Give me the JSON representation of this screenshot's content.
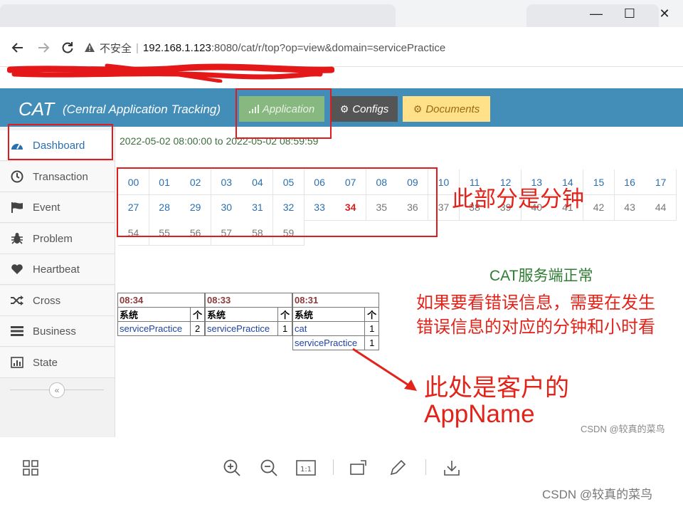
{
  "browser": {
    "insecure_label": "不安全",
    "url_host": "192.168.1.123",
    "url_rest": ":8080/cat/r/top?op=view&domain=servicePractice",
    "window_minimize": "—",
    "window_maximize": "☐",
    "window_close": "✕"
  },
  "header": {
    "brand": "CAT",
    "brand_sub": "(Central Application Tracking)",
    "application_label": "Application",
    "configs_label": "Configs",
    "documents_label": "Documents"
  },
  "sidebar": {
    "items": [
      {
        "label": "Dashboard",
        "icon": "dashboard-icon"
      },
      {
        "label": "Transaction",
        "icon": "clock-icon"
      },
      {
        "label": "Event",
        "icon": "flag-icon"
      },
      {
        "label": "Problem",
        "icon": "bug-icon"
      },
      {
        "label": "Heartbeat",
        "icon": "heart-icon"
      },
      {
        "label": "Cross",
        "icon": "shuffle-icon"
      },
      {
        "label": "Business",
        "icon": "list-icon"
      },
      {
        "label": "State",
        "icon": "bar-chart-icon"
      }
    ],
    "collapse_symbol": "«"
  },
  "content": {
    "date_range": "2022-05-02 08:00:00 to 2022-05-02 08:59:59",
    "minutes_row1": [
      "00",
      "01",
      "02",
      "03",
      "04",
      "05",
      "06",
      "07",
      "08",
      "09",
      "10",
      "11",
      "12",
      "13",
      "14",
      "15",
      "16",
      "17"
    ],
    "minutes_row2": [
      "27",
      "28",
      "29",
      "30",
      "31",
      "32",
      "33",
      "34",
      "35",
      "36",
      "37",
      "38",
      "39",
      "40",
      "41",
      "42",
      "43",
      "44"
    ],
    "minutes_row3": [
      "54",
      "55",
      "56",
      "57",
      "58",
      "59"
    ],
    "current_minute": "34",
    "tables": [
      {
        "title": "08:34",
        "col_header": "系统",
        "sort": "个",
        "rows": [
          {
            "name": "servicePractice",
            "count": "2"
          }
        ]
      },
      {
        "title": "08:33",
        "col_header": "系统",
        "sort": "个",
        "rows": [
          {
            "name": "servicePractice",
            "count": "1"
          }
        ]
      },
      {
        "title": "08:31",
        "col_header": "系统",
        "sort": "个",
        "rows": [
          {
            "name": "cat",
            "count": "1"
          },
          {
            "name": "servicePractice",
            "count": "1"
          }
        ]
      }
    ]
  },
  "annotations": {
    "minutes_note": "此部分是分钟",
    "server_ok": "CAT服务端正常",
    "hint_line1": "如果要看错误信息，需要在发生",
    "hint_line2": "错误信息的对应的分钟和小时看",
    "appname_line1": "此处是客户的",
    "appname_line2": "AppName",
    "watermark_small": "CSDN @较真的菜鸟",
    "watermark_large": "CSDN @较真的菜鸟"
  },
  "colors": {
    "header_bg": "#438eb9",
    "application_btn": "#87b87f",
    "configs_btn": "#555555",
    "documents_btn": "#fee188",
    "annotation_red": "#e2231a"
  }
}
